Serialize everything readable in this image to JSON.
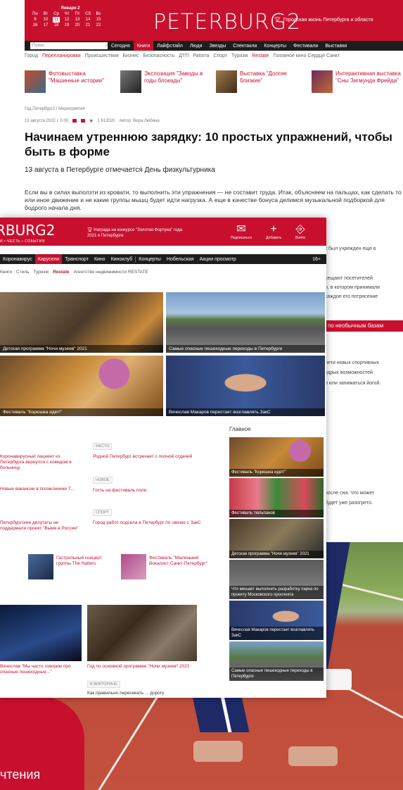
{
  "back": {
    "calendar": {
      "title": "Января 2",
      "rows": [
        [
          "Пн",
          "Вт",
          "Ср",
          "Чт",
          "Пт",
          "Сб",
          "Вс"
        ],
        [
          "9",
          "10",
          "11",
          "12",
          "13",
          "14",
          "15"
        ],
        [
          "16",
          "17",
          "18",
          "19",
          "20",
          "21",
          "22"
        ]
      ],
      "today": "11"
    },
    "logo": "PETERBURG2",
    "brand_right": "Городская жизнь Петербурга и области",
    "search_placeholder": "Поиск",
    "menu": [
      "Сегодня",
      "Книги",
      "Лайфстайл",
      "Люди",
      "Звезды",
      "Спектакли",
      "Концерты",
      "Фестивали",
      "Выставки"
    ],
    "subnav": [
      "Город",
      "Перепланировки",
      "Происшествия",
      "Бизнес",
      "Безопасность",
      "ДТП",
      "Работа",
      "Спорт",
      "Туризм",
      "Restate",
      "Головное кино Сердце Санкт"
    ],
    "features": [
      {
        "text": "Фотовыставка \"Машинные истории\""
      },
      {
        "text": "Экспозиция \"Заводы в годы блокады\""
      },
      {
        "text": "Выставка \"Долгие близкие\""
      },
      {
        "text": "Интерактивная выставка \"Сны Зигмунда Фрейда\""
      }
    ],
    "crumb": "Год Петербург2 / Мероприятия",
    "meta_date": "13 августа 2022 г. 0:00",
    "meta_views": "1 612020",
    "meta_author": "Автор: Вера Любина",
    "headline": "Начинаем утреннюю зарядку: 10 простых упражнений, чтобы быть в форме",
    "lead": "13 августа в Петербурге отмечается День физкультурника",
    "body": "Если вы в силах выползти из кровати, то выполнить эти упражнения — не составит труда. Итак, объясняем на пальцах, как сделать то или иное движение и не какие группы мышц будет идти нагрузка. А еще в качестве бонуса делимся музыкальной подборкой для бодрого начала дня.",
    "side": [
      "к был учрежден еще в",
      "сещают посетителей",
      "о, в котором принимали",
      "каждое его потрясение",
      "по необычным базам",
      "лети новых спортивных",
      "удрых возможностей",
      "и или заниматься йогой.",
      "после сна. Что может",
      "будет уже разогрето."
    ],
    "corner_text": "чтения"
  },
  "front": {
    "logo": "RBURG2",
    "logo_sub": "И • ЧЕСТЬ • СОБЫТИЯ",
    "award": "Награда на конкурсе \"Золотая Фортуна\" года 2021 в Петербурге",
    "icons": [
      {
        "name": "Подписаться",
        "glyph": "✉"
      },
      {
        "name": "Добавить",
        "glyph": "+"
      },
      {
        "name": "Войти",
        "glyph": "⎆"
      }
    ],
    "menu": [
      "Коронавирус",
      "Карусели",
      "Транспорт",
      "Кино",
      "Киноклуб",
      "Концерты",
      "Нобельская",
      "Акции просмотр"
    ],
    "menu_right": "16+",
    "sub": [
      "Книги",
      "Стиль",
      "Туризм",
      "Restate",
      "Агентство недвижимости RESTATE"
    ],
    "tiles": [
      {
        "caption": "Детская программа \"Ночи музеев\" 2021"
      },
      {
        "caption": "Самые опасные пешеходные переходы в Петербурге"
      },
      {
        "caption": "Фестиваль \"Корюшка идет!\""
      },
      {
        "caption": "Вячеслав Макаров перестает возглавлять ЗакС"
      }
    ],
    "main_title": "Главное",
    "left_news": [
      "Коронавирусный пациент из Петербурга вернулся с ковидом в больницу",
      "Новые вакансии в поликлинике Т...",
      "Петербургские депутаты не поддержали проект \"Вымя в России\""
    ],
    "mid_news": [
      {
        "tag": "МЕСТО",
        "text": "Родной Петербург встречает с полной отдачей"
      },
      {
        "tag": "НОВОЕ",
        "text": "Гость на фестиваль поле"
      },
      {
        "tag": "СПОРТ",
        "text": "Город работ подсела в Петербург по связке с ЗакС"
      }
    ],
    "bottom_row": [
      {
        "text": "Гастрольный концерт группы The Hatters"
      },
      {
        "text": "Фестиваль \"Маленький Вокалист Санкт Петербург\""
      }
    ],
    "bottom_left": "Вячеслав \"Мы часто говорим про опасные пешеходные...\"",
    "bottom_mid": "Гид по основной программе \"Ночи музеев\" 2021",
    "bottom_tag": "В ВИКТОРИНЕ",
    "bottom_last": "Как правильно пересекать ... дорогу",
    "right_tiles": [
      {
        "caption": "Фестиваль \"Корюшка идет!\""
      },
      {
        "caption": "Фестиваль тюльпанов"
      },
      {
        "caption": "Детская программа \"Ночи музеев\" 2021"
      },
      {
        "caption": "Что мешает выполнить разработку парка по проекту Московского проспекта"
      },
      {
        "caption": "Вячеслав Макаров перестает возглавлять ЗакС"
      },
      {
        "caption": "Самые опасные пешеходные переходы в Петербурге"
      }
    ]
  }
}
